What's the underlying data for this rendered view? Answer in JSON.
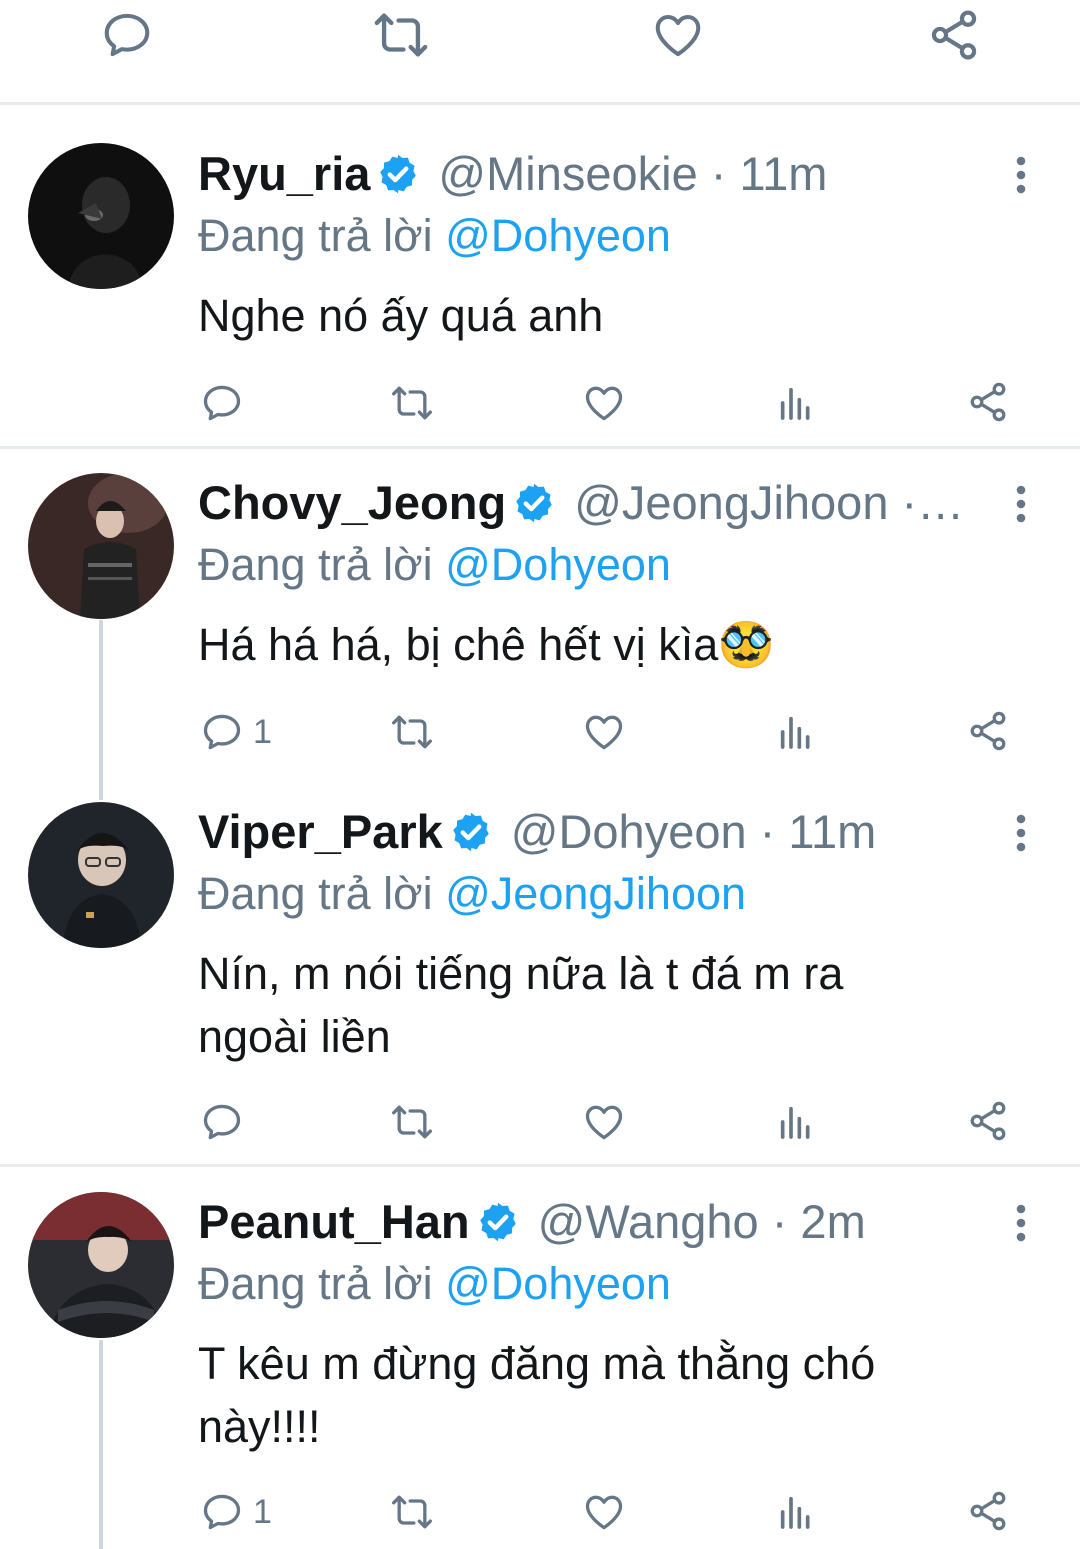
{
  "top_actions": [
    {
      "icon": "reply-icon"
    },
    {
      "icon": "retweet-icon"
    },
    {
      "icon": "like-icon"
    },
    {
      "icon": "share-icon"
    }
  ],
  "reply_prefix": "Đang trả lời",
  "tweets": [
    {
      "name": "Ryu_ria",
      "handle": "@Minseokie · 11m",
      "reply_to": "@Dohyeon",
      "text": "Nghe nó ấy quá anh",
      "reply_count": "",
      "avatar_colors": [
        "#1c1c1c",
        "#3a3a3a"
      ]
    },
    {
      "name": "Chovy_Jeong",
      "handle": "@JeongJihoon ·…",
      "reply_to": "@Dohyeon",
      "text": "Há há há, bị chê hết vị kìa🥸",
      "reply_count": "1",
      "avatar_colors": [
        "#3b2a2a",
        "#6b4a45"
      ]
    },
    {
      "name": "Viper_Park",
      "handle": "@Dohyeon · 11m",
      "reply_to": "@JeongJihoon",
      "text": "Nín, m nói tiếng nữa là t đá m ra ngoài liền",
      "reply_count": "",
      "avatar_colors": [
        "#20262c",
        "#4b5560"
      ]
    },
    {
      "name": "Peanut_Han",
      "handle": "@Wangho · 2m",
      "reply_to": "@Dohyeon",
      "text": "T kêu m đừng đăng mà thằng chó này!!!!",
      "reply_count": "1",
      "avatar_colors": [
        "#6b2b2b",
        "#2c2f36"
      ]
    }
  ],
  "colors": {
    "accent": "#1da1f2",
    "icon_gray": "#657786",
    "divider": "#e6ecf0",
    "thread_line": "#ccd6dd",
    "text": "#14171a"
  }
}
